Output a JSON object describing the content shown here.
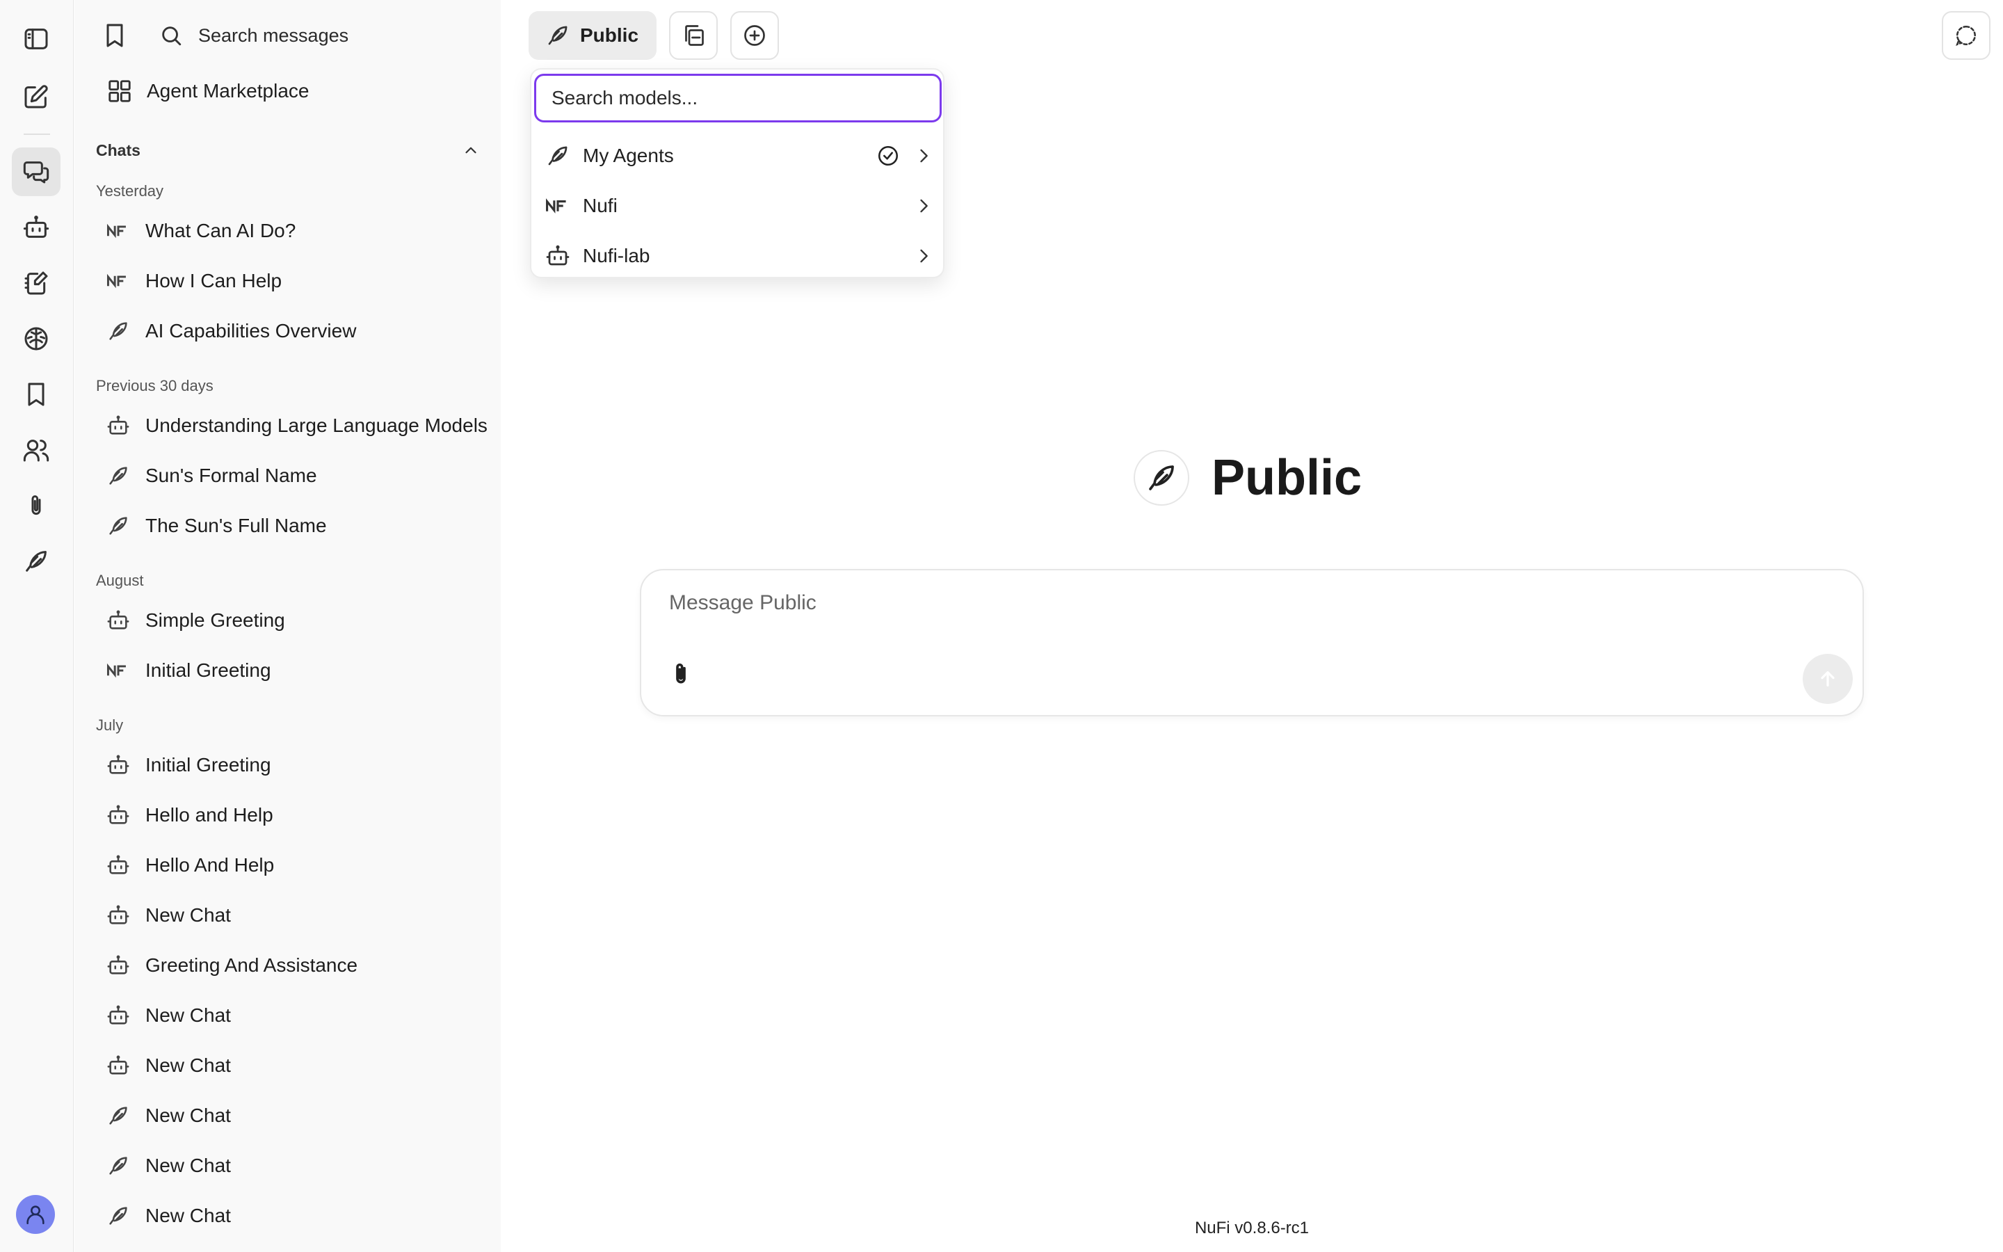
{
  "rail": {
    "items": [
      {
        "icon": "sidebar-toggle-icon"
      },
      {
        "icon": "new-chat-icon"
      },
      {
        "icon": "chats-icon",
        "active": true
      },
      {
        "icon": "bot-icon"
      },
      {
        "icon": "notebook-icon"
      },
      {
        "icon": "brain-icon"
      },
      {
        "icon": "bookmark-icon"
      },
      {
        "icon": "users-icon"
      },
      {
        "icon": "paperclip-icon"
      },
      {
        "icon": "feather-icon"
      }
    ],
    "avatar_icon": "user-icon"
  },
  "sidebar": {
    "search_label": "Search messages",
    "marketplace_label": "Agent Marketplace",
    "chats_header": "Chats",
    "groups": [
      {
        "label": "Yesterday",
        "items": [
          {
            "title": "What Can AI Do?",
            "icon": "nufi-logo-icon"
          },
          {
            "title": "How I Can Help",
            "icon": "nufi-logo-icon"
          },
          {
            "title": "AI Capabilities Overview",
            "icon": "feather-icon"
          }
        ]
      },
      {
        "label": "Previous 30 days",
        "items": [
          {
            "title": "Understanding Large Language Models",
            "icon": "bot-icon"
          },
          {
            "title": "Sun's Formal Name",
            "icon": "feather-icon"
          },
          {
            "title": "The Sun's Full Name",
            "icon": "feather-icon"
          }
        ]
      },
      {
        "label": "August",
        "items": [
          {
            "title": "Simple Greeting",
            "icon": "bot-icon"
          },
          {
            "title": "Initial Greeting",
            "icon": "nufi-logo-icon"
          }
        ]
      },
      {
        "label": "July",
        "items": [
          {
            "title": "Initial Greeting",
            "icon": "bot-icon"
          },
          {
            "title": "Hello and Help",
            "icon": "bot-icon"
          },
          {
            "title": "Hello And Help",
            "icon": "bot-icon"
          },
          {
            "title": "New Chat",
            "icon": "bot-icon"
          },
          {
            "title": "Greeting And Assistance",
            "icon": "bot-icon"
          },
          {
            "title": "New Chat",
            "icon": "bot-icon"
          },
          {
            "title": "New Chat",
            "icon": "bot-icon"
          },
          {
            "title": "New Chat",
            "icon": "feather-icon"
          },
          {
            "title": "New Chat",
            "icon": "feather-icon"
          },
          {
            "title": "New Chat",
            "icon": "feather-icon"
          }
        ]
      }
    ]
  },
  "header": {
    "model_label": "Public"
  },
  "model_dropdown": {
    "search_placeholder": "Search models...",
    "items": [
      {
        "label": "My Agents",
        "icon": "feather-icon",
        "selected": true
      },
      {
        "label": "Nufi",
        "icon": "nufi-logo-icon",
        "selected": false
      },
      {
        "label": "Nufi-lab",
        "icon": "bot-icon",
        "selected": false
      }
    ]
  },
  "main": {
    "title": "Public",
    "composer_placeholder": "Message Public",
    "version": "NuFi v0.8.6-rc1"
  },
  "colors": {
    "accent": "#7c3aed",
    "avatar": "#7a85f0",
    "sidebar_bg": "#f9f9f9"
  }
}
